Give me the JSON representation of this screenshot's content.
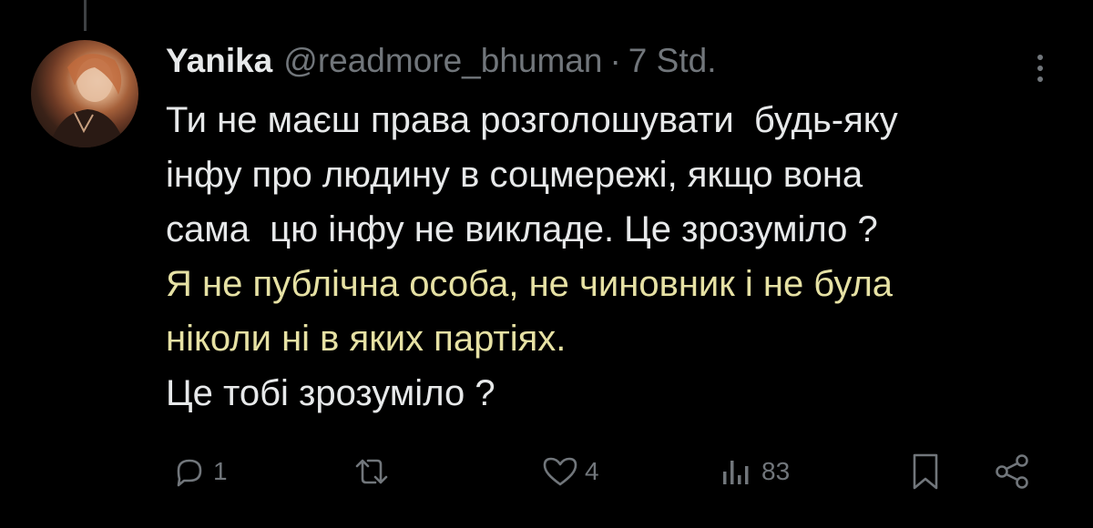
{
  "tweet": {
    "author": {
      "name": "Yanika",
      "handle": "@readmore_bhuman",
      "separator": "·",
      "time": "7 Std."
    },
    "lines": [
      {
        "text": "Ти не маєш права розголошувати  будь-яку",
        "style": "normal"
      },
      {
        "text": "інфу про людину в соцмережі, якщо вона",
        "style": "normal"
      },
      {
        "text": "сама  цю інфу не викладе. Це зрозуміло ?",
        "style": "normal"
      },
      {
        "text": "Я не публічна особа, не чиновник і не була",
        "style": "highlight"
      },
      {
        "text": "ніколи ні в яких партіях.",
        "style": "highlight"
      },
      {
        "text": "Це тобі зрозуміло ?",
        "style": "normal"
      }
    ],
    "actions": {
      "reply": {
        "icon": "reply-icon",
        "count": "1"
      },
      "retweet": {
        "icon": "retweet-icon",
        "count": ""
      },
      "like": {
        "icon": "heart-icon",
        "count": "4"
      },
      "views": {
        "icon": "views-icon",
        "count": "83"
      },
      "bookmark": {
        "icon": "bookmark-icon"
      },
      "share": {
        "icon": "share-icon"
      }
    }
  },
  "colors": {
    "background": "#000000",
    "text": "#e7e9ea",
    "secondary": "#71767b",
    "highlight": "#e6e1a4",
    "thread_line": "#3e4144"
  }
}
